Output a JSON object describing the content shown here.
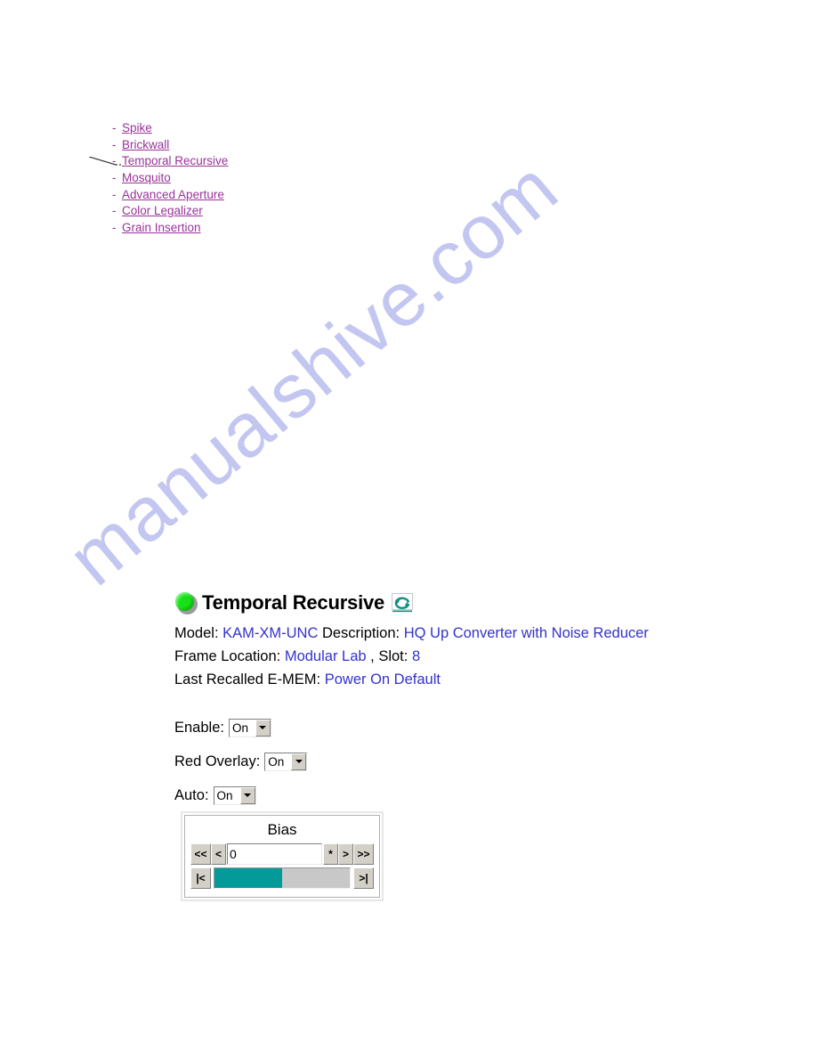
{
  "watermark": {
    "text": "manualshive.com",
    "color": "#c3c6f0"
  },
  "nav": {
    "bullet": "-",
    "items": [
      {
        "label": "Spike"
      },
      {
        "label": "Brickwall"
      },
      {
        "label": "Temporal Recursive"
      },
      {
        "label": "Mosquito"
      },
      {
        "label": "Advanced Aperture"
      },
      {
        "label": "Color Legalizer"
      },
      {
        "label": "Grain Insertion"
      }
    ],
    "link_color": "#993399"
  },
  "panel": {
    "status_led": "green-led-icon",
    "title": "Temporal Recursive",
    "refresh_icon": "refresh-icon",
    "info": {
      "model_label": "Model:",
      "model_value": "KAM-XM-UNC",
      "description_label": "Description:",
      "description_value": "HQ Up Converter with Noise Reducer",
      "frame_location_label": "Frame Location:",
      "frame_location_value": "Modular Lab",
      "slot_label": ", Slot:",
      "slot_value": "8",
      "emem_label": "Last Recalled E-MEM:",
      "emem_value": "Power On Default"
    },
    "value_color": "#3333cc",
    "fields": [
      {
        "label": "Enable:",
        "value": "On"
      },
      {
        "label": "Red Overlay:",
        "value": "On"
      },
      {
        "label": "Auto:",
        "value": "On"
      }
    ],
    "bias": {
      "title": "Bias",
      "value": "0",
      "fill_percent": 50,
      "fill_color": "#059a9a",
      "buttons": {
        "first": "<<",
        "prev": "<",
        "reset": "*",
        "next": ">",
        "last": ">>",
        "slider_min": "|<",
        "slider_max": ">|"
      }
    }
  }
}
